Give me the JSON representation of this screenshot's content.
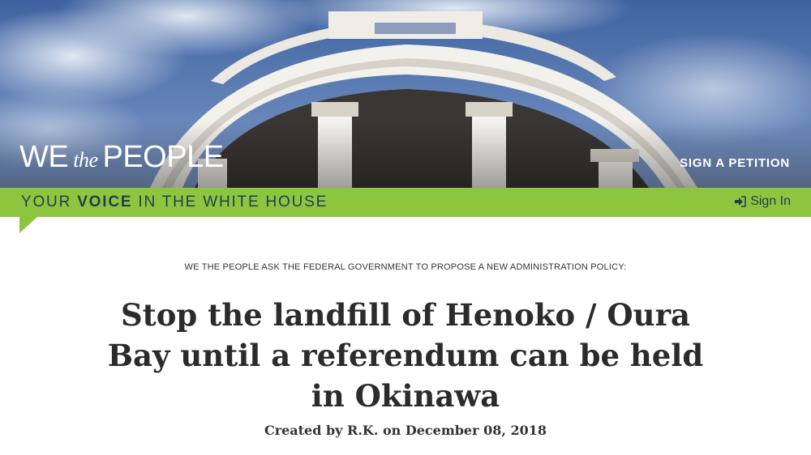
{
  "header": {
    "logo": {
      "we": "WE",
      "the": "the",
      "people": "PEOPLE"
    },
    "sign_petition_label": "SIGN A PETITION"
  },
  "banner": {
    "tagline_prefix": "YOUR ",
    "tagline_strong": "VOICE",
    "tagline_suffix": " IN THE WHITE HOUSE",
    "sign_in_label": "Sign In",
    "accent_color": "#8cc63f"
  },
  "petition": {
    "ask_line": "WE THE PEOPLE ASK THE FEDERAL GOVERNMENT TO PROPOSE A NEW ADMINISTRATION POLICY:",
    "title": "Stop the landfill of Henoko / Oura Bay until a referendum can be held in Okinawa",
    "created": "Created by R.K. on December 08, 2018"
  }
}
